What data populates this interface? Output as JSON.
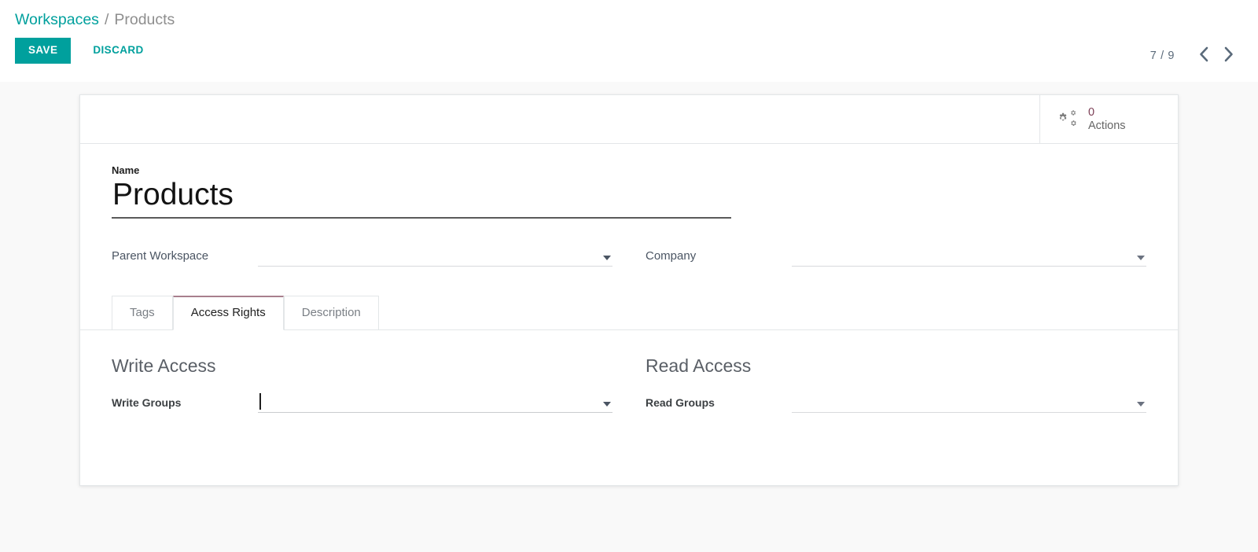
{
  "breadcrumb": {
    "root": "Workspaces",
    "separator": "/",
    "current": "Products"
  },
  "toolbar": {
    "save_label": "SAVE",
    "discard_label": "DISCARD"
  },
  "pager": {
    "value": "7 / 9",
    "previous_icon": "chevron-left-icon",
    "next_icon": "chevron-right-icon"
  },
  "stat_buttons": [
    {
      "icon": "cogs-icon",
      "value": "0",
      "label": "Actions"
    }
  ],
  "form": {
    "name": {
      "label": "Name",
      "value": "Products",
      "placeholder": ""
    },
    "parent_workspace": {
      "label": "Parent Workspace",
      "value": "",
      "placeholder": ""
    },
    "company": {
      "label": "Company",
      "value": "",
      "placeholder": ""
    }
  },
  "notebook": {
    "tabs": [
      {
        "label": "Tags",
        "active": false
      },
      {
        "label": "Access Rights",
        "active": true
      },
      {
        "label": "Description",
        "active": false
      }
    ]
  },
  "access_rights": {
    "write": {
      "title": "Write Access",
      "field_label": "Write Groups",
      "value": "",
      "placeholder": ""
    },
    "read": {
      "title": "Read Access",
      "field_label": "Read Groups",
      "value": "",
      "placeholder": ""
    }
  },
  "colors": {
    "accent": "#00a09d",
    "active_tab_border": "#a87f8d",
    "stat_value": "#7c3f56",
    "page_background": "#f9f9f9"
  }
}
